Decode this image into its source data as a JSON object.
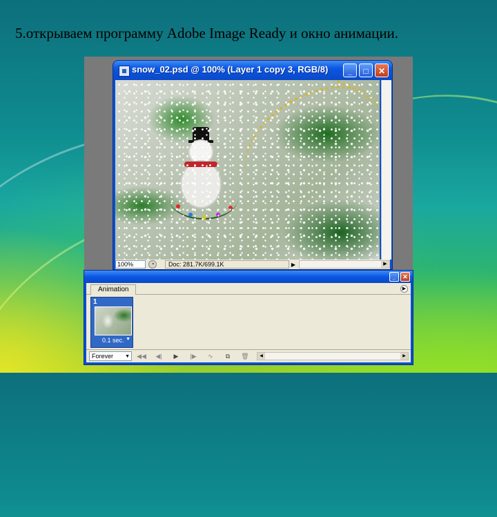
{
  "slide": {
    "title": "5.открываем программу Adobe Image Ready и окно анимации."
  },
  "image_window": {
    "title": "snow_02.psd @ 100% (Layer 1 copy 3, RGB/8)",
    "buttons": {
      "minimize": "_",
      "maximize": "□",
      "close": "✕"
    },
    "status": {
      "zoom": "100%",
      "doc_info": "Doc: 281.7K/699.1K",
      "arrow": "▶"
    }
  },
  "animation_palette": {
    "tab_label": "Animation",
    "buttons": {
      "minimize": "_",
      "close": "✕"
    },
    "frames": [
      {
        "number": "1",
        "delay": "0.1 sec."
      }
    ],
    "loop_option": "Forever",
    "controls": {
      "first": "◀◀",
      "prev": "◀|",
      "play": "▶",
      "next": "|▶",
      "tween": "∿",
      "duplicate": "⧉",
      "delete": "🗑"
    }
  },
  "colors": {
    "xp_blue": "#0a4fd6",
    "xp_face": "#ece9d8",
    "frame_selected": "#3169c6"
  },
  "icons": {
    "document": "document-icon",
    "status": "status-icon",
    "palette_menu": "palette-menu-icon"
  }
}
